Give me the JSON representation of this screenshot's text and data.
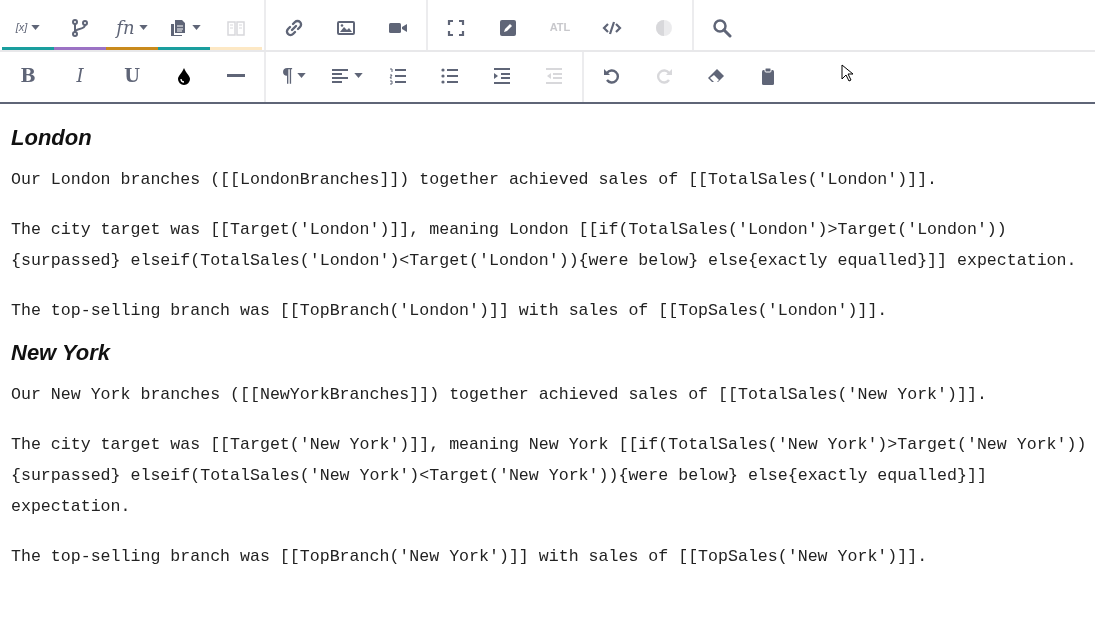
{
  "toolbar_top": [
    [
      {
        "kind": "text",
        "label": "[x]",
        "italic": true,
        "dropdown": true,
        "disabled": false,
        "color": "#1a9e9e"
      },
      {
        "kind": "icon",
        "dropdown": false,
        "disabled": false,
        "color": "#9b72c4"
      },
      {
        "kind": "text",
        "label": "fn",
        "italic": true,
        "dropdown": true,
        "disabled": false,
        "color": "#c98a1c"
      },
      {
        "kind": "icon",
        "dropdown": true,
        "disabled": false,
        "color": "#1a9e9e"
      },
      {
        "kind": "icon",
        "dropdown": false,
        "disabled": true,
        "color": "#fde8c4"
      }
    ],
    [
      {
        "kind": "icon",
        "dropdown": false,
        "disabled": false
      },
      {
        "kind": "icon",
        "dropdown": false,
        "disabled": false
      },
      {
        "kind": "icon",
        "dropdown": false,
        "disabled": false
      }
    ],
    [
      {
        "kind": "icon",
        "dropdown": false,
        "disabled": false
      },
      {
        "kind": "icon",
        "dropdown": false,
        "disabled": false
      },
      {
        "kind": "text",
        "label": "ATL",
        "italic": false,
        "dropdown": false,
        "disabled": true
      },
      {
        "kind": "icon",
        "dropdown": false,
        "disabled": false
      },
      {
        "kind": "icon",
        "dropdown": false,
        "disabled": true
      }
    ],
    [
      {
        "kind": "icon",
        "dropdown": false,
        "disabled": false
      }
    ]
  ],
  "toolbar_bottom": [
    [
      {
        "kind": "text",
        "label": "B",
        "italic": false,
        "dropdown": false,
        "disabled": false
      },
      {
        "kind": "text",
        "label": "I",
        "italic": true,
        "dropdown": false,
        "disabled": false
      },
      {
        "kind": "text",
        "label": "U",
        "italic": false,
        "dropdown": false,
        "disabled": false
      },
      {
        "kind": "icon",
        "dropdown": false,
        "disabled": false
      },
      {
        "kind": "icon",
        "dropdown": false,
        "disabled": false
      }
    ],
    [
      {
        "kind": "text",
        "label": "¶",
        "italic": false,
        "dropdown": true,
        "disabled": false
      },
      {
        "kind": "icon",
        "dropdown": true,
        "disabled": false
      },
      {
        "kind": "icon",
        "dropdown": false,
        "disabled": false
      },
      {
        "kind": "icon",
        "dropdown": false,
        "disabled": false
      },
      {
        "kind": "icon",
        "dropdown": false,
        "disabled": false
      },
      {
        "kind": "icon",
        "dropdown": false,
        "disabled": true
      }
    ],
    [
      {
        "kind": "icon",
        "dropdown": false,
        "disabled": false
      },
      {
        "kind": "icon",
        "dropdown": false,
        "disabled": true
      },
      {
        "kind": "icon",
        "dropdown": false,
        "disabled": false
      },
      {
        "kind": "icon",
        "dropdown": false,
        "disabled": false
      }
    ]
  ],
  "sections": [
    {
      "heading": "London",
      "paragraphs": [
        [
          "Our London branches ([[LondonBranches]]) together achieved sales of [[TotalSales('London')]]."
        ],
        [
          "The city target was [[Target('London')]], meaning London [[if(TotalSales('London')>Target('London'))",
          "{surpassed} elseif(TotalSales('London')<Target('London')){were below} else{exactly equalled}]] expectation."
        ],
        [
          "The top-selling branch was [[TopBranch('London')]] with sales of [[TopSales('London')]]."
        ]
      ]
    },
    {
      "heading": "New York",
      "paragraphs": [
        [
          "Our New York branches ([[NewYorkBranches]]) together achieved sales of [[TotalSales('New York')]]."
        ],
        [
          "The city target was [[Target('New York')]], meaning New York [[if(TotalSales('New York')>Target('New York'))",
          "{surpassed} elseif(TotalSales('New York')<Target('New York')){were below} else{exactly equalled}]]",
          "expectation."
        ],
        [
          "The top-selling branch was [[TopBranch('New York')]] with sales of [[TopSales('New York')]]."
        ]
      ]
    }
  ]
}
